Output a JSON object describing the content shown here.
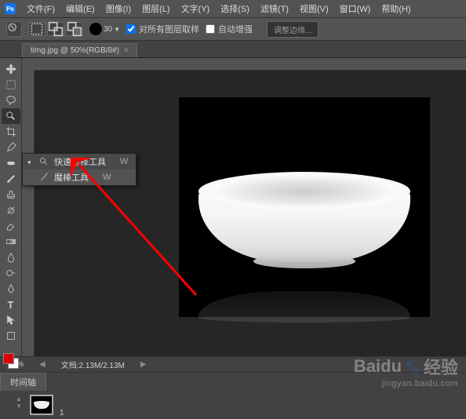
{
  "menu": {
    "file": "文件(F)",
    "edit": "编辑(E)",
    "image": "图像(I)",
    "layer": "图层(L)",
    "type": "文字(Y)",
    "select": "选择(S)",
    "filter": "滤镜(T)",
    "view": "视图(V)",
    "window": "窗口(W)",
    "help": "帮助(H)"
  },
  "options": {
    "brush_size": "30",
    "sample_all": "对所有图层取样",
    "auto_enhance": "自动增强",
    "refine_edge": "调整边缘..."
  },
  "tab": {
    "title": "timg.jpg @ 50%(RGB/8#)",
    "close": "×"
  },
  "flyout": {
    "items": [
      {
        "label": "快速选择工具",
        "shortcut": "W",
        "selected": true
      },
      {
        "label": "魔棒工具",
        "shortcut": "W",
        "selected": false
      }
    ]
  },
  "status": {
    "zoom": "50%",
    "doc": "文档:2.13M/2.13M"
  },
  "timeline": {
    "tab": "时间轴"
  },
  "layers": {
    "frame_num": "1"
  },
  "watermark": {
    "main": "Baidu 经验",
    "sub": "jingyan.baidu.com"
  }
}
